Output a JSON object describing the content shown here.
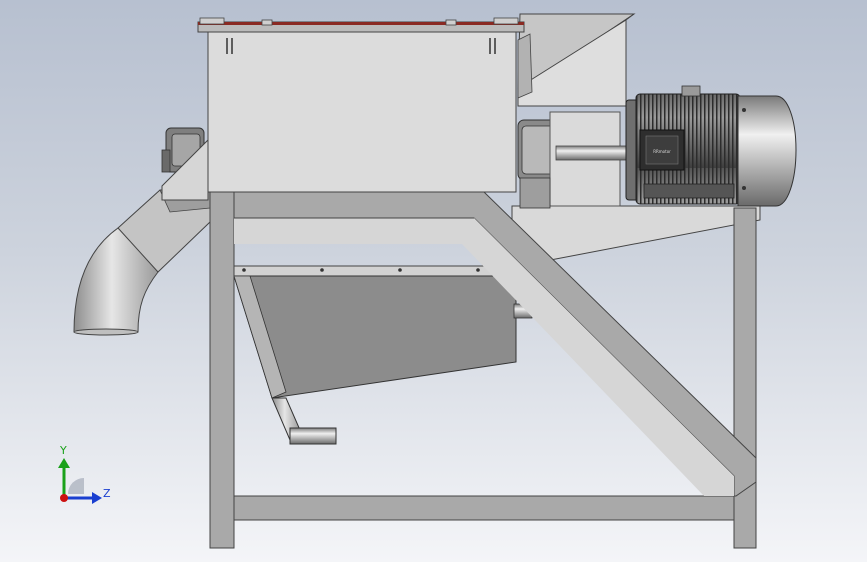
{
  "view": {
    "background_top": "#b7c0d0",
    "background_bottom": "#f4f5f8"
  },
  "triad": {
    "y_label": "Y",
    "z_label": "Z",
    "y_color": "#1aa11a",
    "z_color": "#1a3fd0",
    "origin_color": "#cc1111"
  },
  "motor": {
    "nameplate_text": "RRmotor"
  },
  "colors": {
    "frame": "#a9a9a9",
    "hopper_top_rim": "#8a2a22",
    "tank_body": "#8c8c8c",
    "housing": "#dcdcdc"
  }
}
